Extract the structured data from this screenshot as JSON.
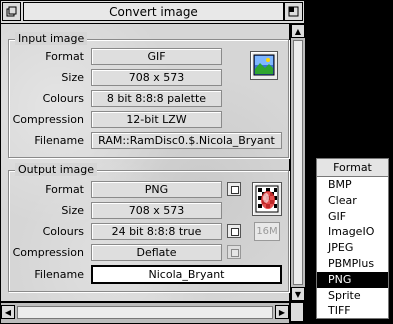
{
  "window": {
    "title": "Convert image",
    "back_icon": "back-icon",
    "close_icon": "close-icon",
    "toggle_icon": "toggle-size-icon"
  },
  "input": {
    "group_label": "Input image",
    "rows": [
      {
        "label": "Format",
        "value": "GIF"
      },
      {
        "label": "Size",
        "value": "708 x 573"
      },
      {
        "label": "Colours",
        "value": "8 bit 8:8:8 palette"
      },
      {
        "label": "Compression",
        "value": "12-bit LZW"
      },
      {
        "label": "Filename",
        "value": "RAM::RamDisc0.$.Nicola_Bryant"
      }
    ],
    "icon": "gif-file-icon"
  },
  "output": {
    "group_label": "Output image",
    "rows": [
      {
        "label": "Format",
        "value": "PNG"
      },
      {
        "label": "Size",
        "value": "708 x 573"
      },
      {
        "label": "Colours",
        "value": "24 bit 8:8:8 true"
      },
      {
        "label": "Compression",
        "value": "Deflate"
      },
      {
        "label": "Filename",
        "value": "Nicola_Bryant"
      }
    ],
    "icon": "png-file-icon",
    "colours_tag": "16M"
  },
  "format_menu": {
    "title": "Format",
    "items": [
      "BMP",
      "Clear",
      "GIF",
      "ImageIO",
      "JPEG",
      "PBMPlus",
      "PNG",
      "Sprite",
      "TIFF"
    ],
    "selected": "PNG"
  },
  "colors": {
    "desktop": "#000000",
    "window_bg": "#d6d6d6",
    "selected_item": "#000000"
  }
}
